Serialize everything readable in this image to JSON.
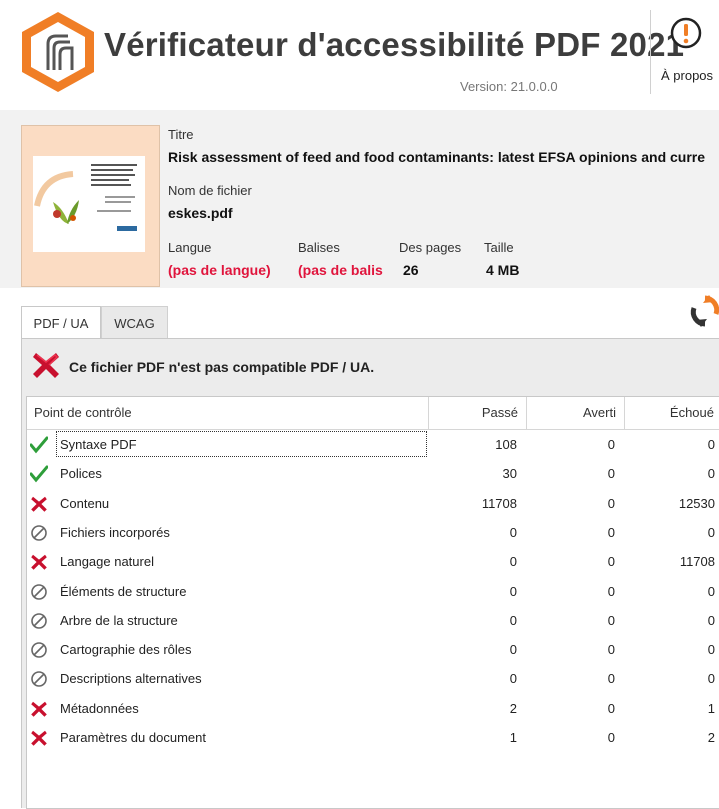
{
  "app": {
    "title": "Vérificateur d'accessibilité PDF 2021",
    "version": "Version: 21.0.0.0",
    "about_label": "À propos",
    "accent": "#f07e26"
  },
  "document": {
    "title_label": "Titre",
    "title_value": "Risk assessment of feed and food contaminants: latest EFSA opinions and curre",
    "filename_label": "Nom de fichier",
    "filename_value": "eskes.pdf",
    "language_label": "Langue",
    "language_value": "(pas de langue)",
    "tags_label": "Balises",
    "tags_value": "(pas de balis",
    "pages_label": "Des pages",
    "pages_value": "26",
    "size_label": "Taille",
    "size_value": "4 MB",
    "warning_color": "#e0143c"
  },
  "tabs": [
    {
      "label": "PDF / UA",
      "active": true
    },
    {
      "label": "WCAG",
      "active": false
    }
  ],
  "result": {
    "status_icon": "fail-x-icon",
    "status_text": "Ce fichier PDF n'est pas compatible PDF / UA."
  },
  "grid": {
    "headers": [
      "Point de contrôle",
      "Passé",
      "Averti",
      "Échoué"
    ],
    "rows": [
      {
        "status": "pass",
        "name": "Syntaxe PDF",
        "passed": "108",
        "warned": "0",
        "failed": "0"
      },
      {
        "status": "pass",
        "name": "Polices",
        "passed": "30",
        "warned": "0",
        "failed": "0"
      },
      {
        "status": "fail",
        "name": "Contenu",
        "passed": "11708",
        "warned": "0",
        "failed": "12530"
      },
      {
        "status": "na",
        "name": "Fichiers incorporés",
        "passed": "0",
        "warned": "0",
        "failed": "0"
      },
      {
        "status": "fail",
        "name": "Langage naturel",
        "passed": "0",
        "warned": "0",
        "failed": "11708"
      },
      {
        "status": "na",
        "name": "Éléments de structure",
        "passed": "0",
        "warned": "0",
        "failed": "0"
      },
      {
        "status": "na",
        "name": "Arbre de la structure",
        "passed": "0",
        "warned": "0",
        "failed": "0"
      },
      {
        "status": "na",
        "name": "Cartographie des rôles",
        "passed": "0",
        "warned": "0",
        "failed": "0"
      },
      {
        "status": "na",
        "name": "Descriptions alternatives",
        "passed": "0",
        "warned": "0",
        "failed": "0"
      },
      {
        "status": "fail",
        "name": "Métadonnées",
        "passed": "2",
        "warned": "0",
        "failed": "1"
      },
      {
        "status": "fail",
        "name": "Paramètres du document",
        "passed": "1",
        "warned": "0",
        "failed": "2"
      }
    ]
  }
}
